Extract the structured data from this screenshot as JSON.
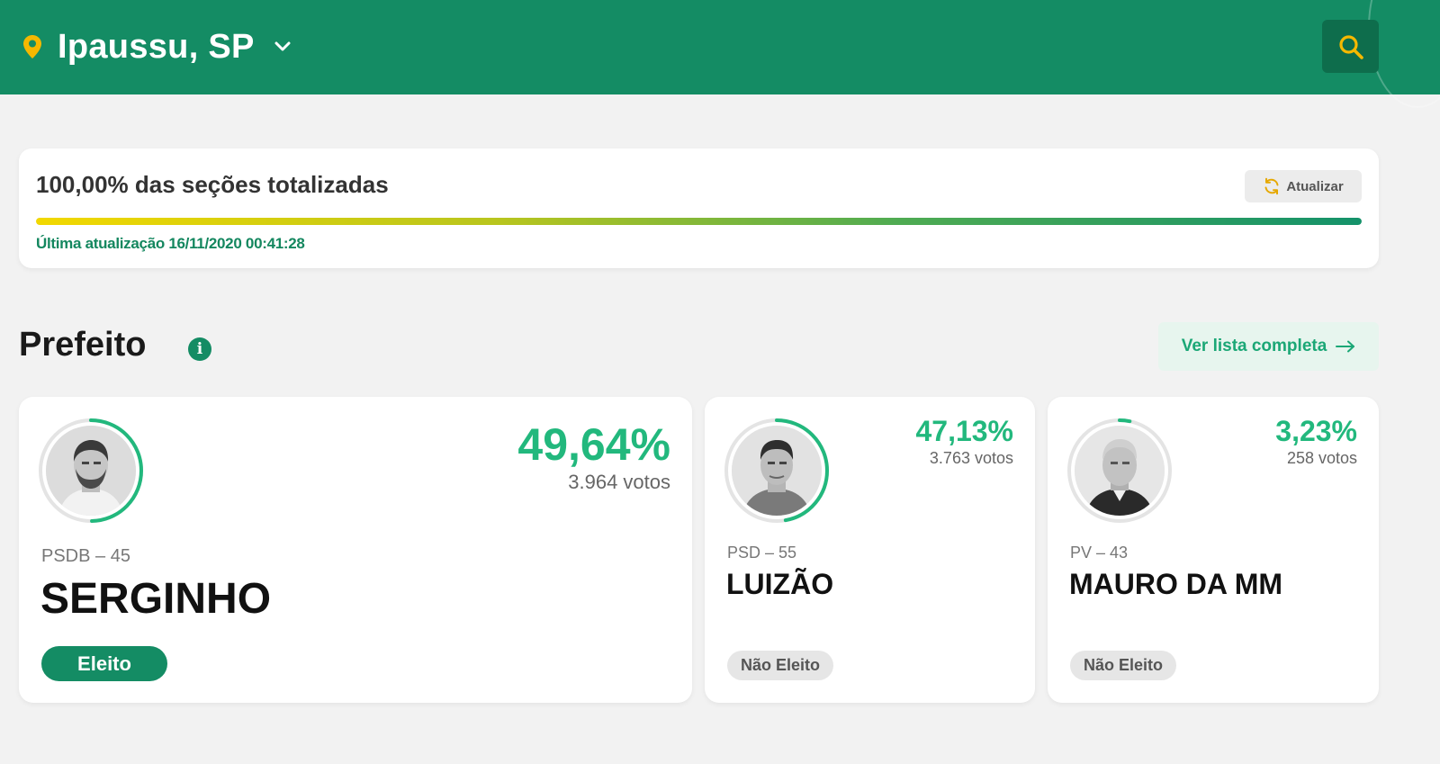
{
  "header": {
    "location": "Ipaussu, SP",
    "location_icon": "map-pin-icon",
    "dropdown_icon": "chevron-down-icon",
    "search_icon": "search-icon",
    "brand_color": "#148c64",
    "pin_color": "#f5b800"
  },
  "status": {
    "title": "100,00% das seções totalizadas",
    "progress_fraction": 1.0,
    "refresh_label": "Atualizar",
    "refresh_icon": "refresh-icon",
    "last_update": "Última atualização 16/11/2020 00:41:28"
  },
  "section": {
    "title": "Prefeito",
    "info_glyph": "i",
    "full_list_label": "Ver lista completa",
    "full_list_icon": "arrow-right-icon"
  },
  "candidates": [
    {
      "percent": "49,64%",
      "percent_value": 49.64,
      "votes": "3.964 votos",
      "party": "PSDB – 45",
      "name": "SERGINHO",
      "status": "Eleito"
    },
    {
      "percent": "47,13%",
      "percent_value": 47.13,
      "votes": "3.763 votos",
      "party": "PSD – 55",
      "name": "LUIZÃO",
      "status": "Não Eleito"
    },
    {
      "percent": "3,23%",
      "percent_value": 3.23,
      "votes": "258 votos",
      "party": "PV – 43",
      "name": "MAURO DA MM",
      "status": "Não Eleito"
    }
  ],
  "colors": {
    "accent_green": "#22b87d",
    "elected_badge": "#148c64",
    "progress_start": "#f2d800",
    "progress_end": "#14926a"
  }
}
